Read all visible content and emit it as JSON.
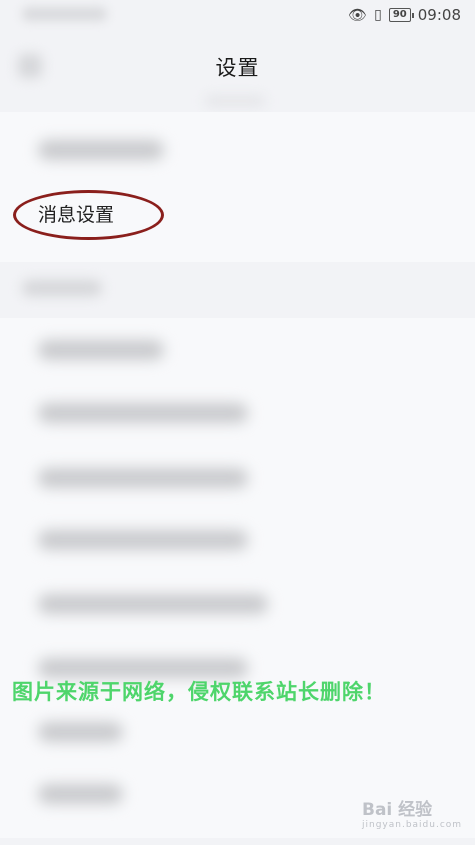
{
  "status": {
    "time": "09:08",
    "battery": "90",
    "eye_icon": "eye-icon",
    "vibrate_icon": "vibrate-icon"
  },
  "header": {
    "title": "设置"
  },
  "settings": {
    "highlighted_item": "消息设置"
  },
  "overlay": {
    "watermark": "图片来源于网络，侵权联系站长删除！",
    "logo_text": "Bai 经验",
    "logo_sub": "jingyan.baidu.com"
  }
}
